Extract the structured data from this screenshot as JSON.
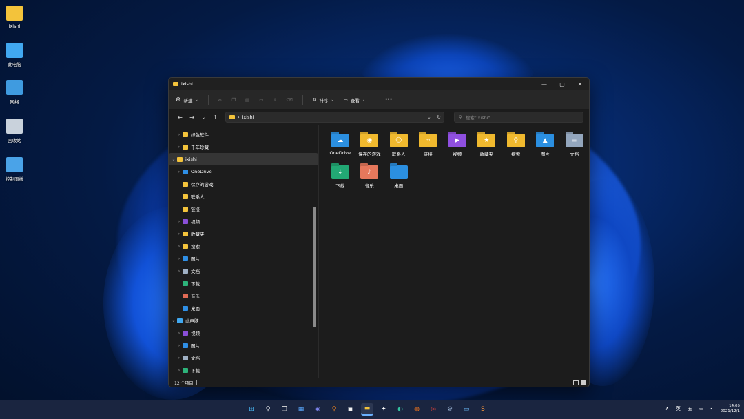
{
  "desktop": {
    "icons": [
      {
        "label": "ixishi",
        "icon": "user-folder-icon",
        "color": "#f3c33b"
      },
      {
        "label": "此电脑",
        "icon": "monitor-icon",
        "color": "#41a8f0"
      },
      {
        "label": "网络",
        "icon": "network-icon",
        "color": "#3f9be0"
      },
      {
        "label": "回收站",
        "icon": "recycle-bin-icon",
        "color": "#c9d2dc"
      },
      {
        "label": "控制面板",
        "icon": "control-panel-icon",
        "color": "#4aa3e8"
      }
    ]
  },
  "window": {
    "title": "ixishi",
    "controls": {
      "minimize": "—",
      "maximize": "▢",
      "close": "✕"
    }
  },
  "commandbar": {
    "new_label": "新建",
    "sort_label": "排序",
    "view_label": "查看",
    "more_label": "···"
  },
  "address": {
    "back": "←",
    "forward": "→",
    "recent": "⌄",
    "up": "↑",
    "path": "ixishi",
    "path_sep": "›",
    "dropdown": "⌄",
    "refresh": "↻",
    "search_placeholder": "搜索\"ixishi\""
  },
  "nav": {
    "items": [
      {
        "label": "绿色软件",
        "chev": "›",
        "indent": 1,
        "icon_color": "#f3c33b"
      },
      {
        "label": "千年珍藏",
        "chev": "›",
        "indent": 1,
        "icon_color": "#f3c33b"
      },
      {
        "label": "ixishi",
        "chev": "⌄",
        "indent": 0,
        "icon_color": "#f3c33b",
        "selected": true
      },
      {
        "label": "OneDrive",
        "chev": "›",
        "indent": 1,
        "icon_color": "#2f8fe6"
      },
      {
        "label": "保存的游戏",
        "chev": "",
        "indent": 1,
        "icon_color": "#f3c33b"
      },
      {
        "label": "联系人",
        "chev": "",
        "indent": 1,
        "icon_color": "#f3c33b"
      },
      {
        "label": "链接",
        "chev": "",
        "indent": 1,
        "icon_color": "#f3c33b"
      },
      {
        "label": "视频",
        "chev": "›",
        "indent": 1,
        "icon_color": "#8a4fd8"
      },
      {
        "label": "收藏夹",
        "chev": "›",
        "indent": 1,
        "icon_color": "#f3c33b"
      },
      {
        "label": "搜索",
        "chev": "›",
        "indent": 1,
        "icon_color": "#f3c33b"
      },
      {
        "label": "图片",
        "chev": "›",
        "indent": 1,
        "icon_color": "#2f8fe6"
      },
      {
        "label": "文档",
        "chev": "›",
        "indent": 1,
        "icon_color": "#9fb0c4"
      },
      {
        "label": "下载",
        "chev": "",
        "indent": 1,
        "icon_color": "#2db37a"
      },
      {
        "label": "音乐",
        "chev": "",
        "indent": 1,
        "icon_color": "#e06a55"
      },
      {
        "label": "桌面",
        "chev": "",
        "indent": 1,
        "icon_color": "#2f8fe6"
      },
      {
        "label": "此电脑",
        "chev": "⌄",
        "indent": 0,
        "icon_color": "#41a8f0"
      },
      {
        "label": "视频",
        "chev": "›",
        "indent": 1,
        "icon_color": "#8a4fd8"
      },
      {
        "label": "图片",
        "chev": "›",
        "indent": 1,
        "icon_color": "#2f8fe6"
      },
      {
        "label": "文档",
        "chev": "›",
        "indent": 1,
        "icon_color": "#9fb0c4"
      },
      {
        "label": "下载",
        "chev": "›",
        "indent": 1,
        "icon_color": "#2db37a"
      }
    ]
  },
  "content": {
    "items": [
      {
        "label": "OneDrive",
        "color": "#2b8fe0",
        "glyph": "☁"
      },
      {
        "label": "保存的游戏",
        "color": "#f0b92e",
        "glyph": "◉"
      },
      {
        "label": "联系人",
        "color": "#f0b92e",
        "glyph": "☺"
      },
      {
        "label": "链接",
        "color": "#f0b92e",
        "glyph": "∞"
      },
      {
        "label": "视频",
        "color": "#8f4fe0",
        "glyph": "▶"
      },
      {
        "label": "收藏夹",
        "color": "#f0b92e",
        "glyph": "★"
      },
      {
        "label": "搜索",
        "color": "#f0b92e",
        "glyph": "⚲"
      },
      {
        "label": "图片",
        "color": "#2b8fe0",
        "glyph": "▲"
      },
      {
        "label": "文档",
        "color": "#93a6bd",
        "glyph": "≡"
      },
      {
        "label": "下载",
        "color": "#22a874",
        "glyph": "↓"
      },
      {
        "label": "音乐",
        "color": "#e6785c",
        "glyph": "♪"
      },
      {
        "label": "桌面",
        "color": "#2b8fe0",
        "glyph": ""
      }
    ]
  },
  "status": {
    "count": "12 个项目",
    "caret": "|"
  },
  "taskbar": {
    "icons": [
      {
        "name": "start-icon",
        "glyph": "⊞",
        "color": "#4cc2ff"
      },
      {
        "name": "search-icon",
        "glyph": "⚲",
        "color": "#ffffff"
      },
      {
        "name": "task-view-icon",
        "glyph": "❐",
        "color": "#dddddd"
      },
      {
        "name": "widgets-icon",
        "glyph": "▦",
        "color": "#5aa9ff"
      },
      {
        "name": "chat-icon",
        "glyph": "◉",
        "color": "#7b83eb"
      },
      {
        "name": "everything-search-icon",
        "glyph": "⚲",
        "color": "#ff8a1c"
      },
      {
        "name": "store-icon",
        "glyph": "▣",
        "color": "#f2f2f2"
      },
      {
        "name": "file-explorer-icon",
        "glyph": "▬",
        "color": "#f3c33b",
        "active": true
      },
      {
        "name": "xmind-icon",
        "glyph": "✦",
        "color": "#ffffff"
      },
      {
        "name": "edge-icon",
        "glyph": "◐",
        "color": "#33c3a0"
      },
      {
        "name": "firefox-icon",
        "glyph": "◍",
        "color": "#ff7a1a"
      },
      {
        "name": "chrome-icon",
        "glyph": "◎",
        "color": "#e8453c"
      },
      {
        "name": "settings-icon",
        "glyph": "⚙",
        "color": "#9fb8d8"
      },
      {
        "name": "remote-desktop-icon",
        "glyph": "▭",
        "color": "#6cc0ff"
      },
      {
        "name": "sublime-icon",
        "glyph": "S",
        "color": "#ff9a3c"
      }
    ],
    "tray_arrow": "∧",
    "ime_1": "英",
    "ime_2": "五",
    "time": "14:05",
    "date": "2021/12/1"
  }
}
